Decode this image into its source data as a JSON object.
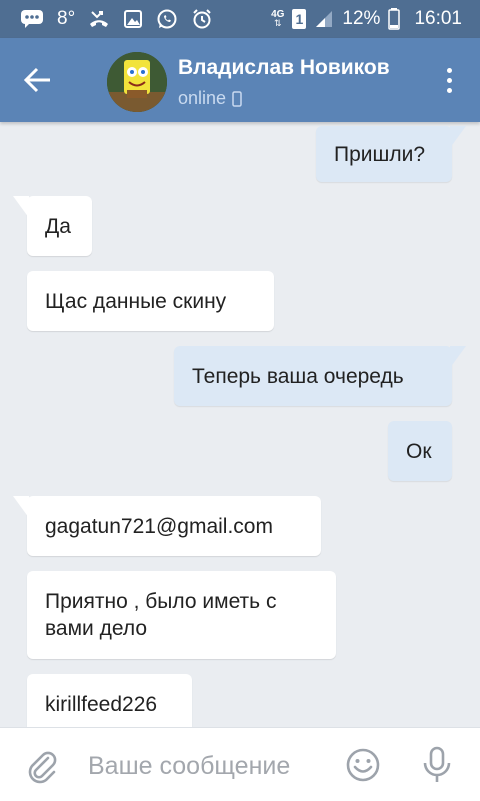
{
  "status_bar": {
    "temperature": "8°",
    "network_type": "4G",
    "sim_slot": "1",
    "battery": "12%",
    "time": "16:01",
    "icons": [
      "chat-icon",
      "missed-call-icon",
      "image-icon",
      "whatsapp-icon",
      "alarm-icon",
      "signal-icon",
      "battery-icon"
    ]
  },
  "header": {
    "contact_name": "Владислав Новиков",
    "status": "online",
    "status_icon": "mobile-phone-icon",
    "avatar": "contact-avatar"
  },
  "messages": [
    {
      "text": "Пришли?",
      "direction": "outgoing"
    },
    {
      "text": "Да",
      "direction": "incoming"
    },
    {
      "text": "Щас данные скину",
      "direction": "incoming"
    },
    {
      "text": "Теперь ваша очередь",
      "direction": "outgoing"
    },
    {
      "text": "Ок",
      "direction": "outgoing"
    },
    {
      "text": "gagatun721@gmail.com",
      "direction": "incoming"
    },
    {
      "text": "Приятно , было иметь с вами дело",
      "direction": "incoming"
    },
    {
      "text": "kirillfeed226",
      "direction": "incoming"
    }
  ],
  "composer": {
    "placeholder": "Ваше сообщение",
    "value": ""
  },
  "colors": {
    "status_bar": "#4f6e92",
    "app_bar": "#5b84b6",
    "chat_background": "#eaedf1",
    "incoming_bubble": "#ffffff",
    "outgoing_bubble": "#dce8f5",
    "icon_gray": "#9da3ab"
  }
}
